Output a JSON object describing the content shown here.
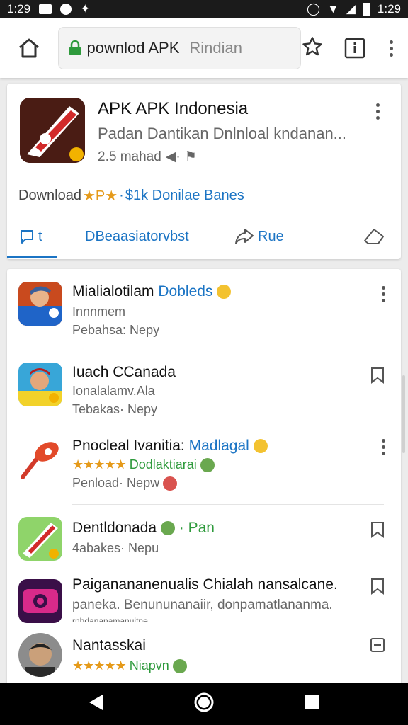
{
  "status_bar": {
    "time_left": "1:29",
    "time_right": "1:29"
  },
  "browser": {
    "url_main": "pownlod APK",
    "url_dim": "Rindian"
  },
  "featured": {
    "title": "APK APK Indonesia",
    "subtitle": "Padan Dantikan Dnlnloal kndanan...",
    "meta": "2.5 mahad",
    "download_prefix": "Download",
    "download_badge": "★P★",
    "download_sep": "·",
    "download_link": "$1k Donilae Banes",
    "actions": [
      {
        "label": "t"
      },
      {
        "label": "DBeaasiatorvbst"
      },
      {
        "label": "Rue"
      }
    ]
  },
  "list": [
    {
      "title": "Mialialotilam",
      "title_accent": "Dobleds",
      "line1": "Innnmem",
      "line2": "Pebahsa: Nepy",
      "action": "more"
    },
    {
      "title": "Iuach CCanada",
      "title_accent": "",
      "line1": "Ionalalamv.Ala",
      "line2": "Tebakas· Nepy",
      "action": "bookmark"
    },
    {
      "title": "Pnocleal Ivanitia:",
      "title_accent": "Madlagal",
      "stars": "★★★★★",
      "line1": "Dodlaktiarai",
      "line2": "Penload· Nepw",
      "action": "more"
    },
    {
      "title": "Dentldonada",
      "title_accent": "· Pan",
      "line1": "",
      "line2": "4abakes· Nepu",
      "action": "bookmark"
    },
    {
      "title": "Paiganananenualis Chialah nansalcane.",
      "title_accent": "",
      "line1": "paneka. Benununanaiir, donpamatlananma.",
      "line2": "rnhdananamanuitne",
      "action": "bookmark"
    },
    {
      "title": "Nantasskai",
      "title_accent": "",
      "stars": "★★★★★",
      "line1": "Niapvn",
      "line2": "",
      "action": "square"
    }
  ],
  "colors": {
    "accent": "#1b74c4",
    "star": "#e59a1a",
    "green": "#2e9a3c"
  }
}
